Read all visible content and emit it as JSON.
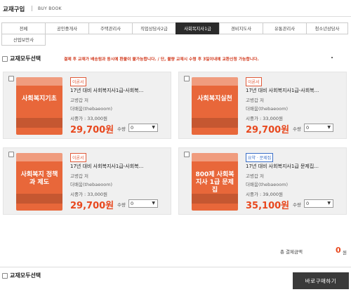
{
  "header": {
    "title": "교재구입",
    "separator": "|",
    "subtitle": "BUY BOOK"
  },
  "tabs": [
    {
      "label": "전체"
    },
    {
      "label": "공인중개사"
    },
    {
      "label": "주택관리사"
    },
    {
      "label": "직업상담사2급"
    },
    {
      "label": "사회복지사1급",
      "active": true
    },
    {
      "label": "경비지도사"
    },
    {
      "label": "유통관리사"
    },
    {
      "label": "청소년상담사"
    },
    {
      "label": "산업보안사"
    }
  ],
  "select_all_label": "교재모두선택",
  "notice": "결제 후 교재가 배송됨과 동시에 환불이 불가능합니다. / 단, 불량 교재시 수령 후 3일이내에 교환신청 가능합니다.",
  "products": [
    {
      "badge": "이론서",
      "badge_color": "#e05a3a",
      "title": "17년 대비 사회복지사1급-사회복...",
      "author": "고병갑 저",
      "publisher": "더배움(thebaeoom)",
      "list_price": "시중가 : 33,000원",
      "price": "29,700원",
      "qty_label": "수량",
      "qty_value": "0",
      "cover": {
        "text": "사회복지기초",
        "color": "#e8673a"
      }
    },
    {
      "badge": "이론서",
      "badge_color": "#e05a3a",
      "title": "17년 대비 사회복지사1급-사회복...",
      "author": "고병갑 저",
      "publisher": "더배움(thebaeoom)",
      "list_price": "시중가 : 33,000원",
      "price": "29,700원",
      "qty_label": "수량",
      "qty_value": "0",
      "cover": {
        "text": "사회복지실천",
        "color": "#e8673a"
      }
    },
    {
      "badge": "이론서",
      "badge_color": "#e05a3a",
      "title": "17년 대비 사회복지사1급-사회복...",
      "author": "고병갑 저",
      "publisher": "더배움(thebaeoom)",
      "list_price": "시중가 : 33,000원",
      "price": "29,700원",
      "qty_label": "수량",
      "qty_value": "0",
      "cover": {
        "text": "사회복지 정책과 제도",
        "color": "#e8673a"
      }
    },
    {
      "badge": "요약 · 문제집",
      "badge_color": "#3a6fc8",
      "title": "17년 대비 사회복지사1급 문제집...",
      "author": "고병갑 저",
      "publisher": "더배움(thebaeoom)",
      "list_price": "시중가 : 39,000원",
      "price": "35,100원",
      "qty_label": "수량",
      "qty_value": "0",
      "cover": {
        "text": "800제 사회복지사 1급 문제집",
        "color": "#e8673a"
      }
    }
  ],
  "total": {
    "label": "총 결제금액",
    "value": "0",
    "unit": "원"
  },
  "buy_button": "바로구매하기",
  "colors": {
    "accent": "#e8481e",
    "active_tab": "#2b2b2b",
    "card_bg": "#f0f0f0"
  }
}
